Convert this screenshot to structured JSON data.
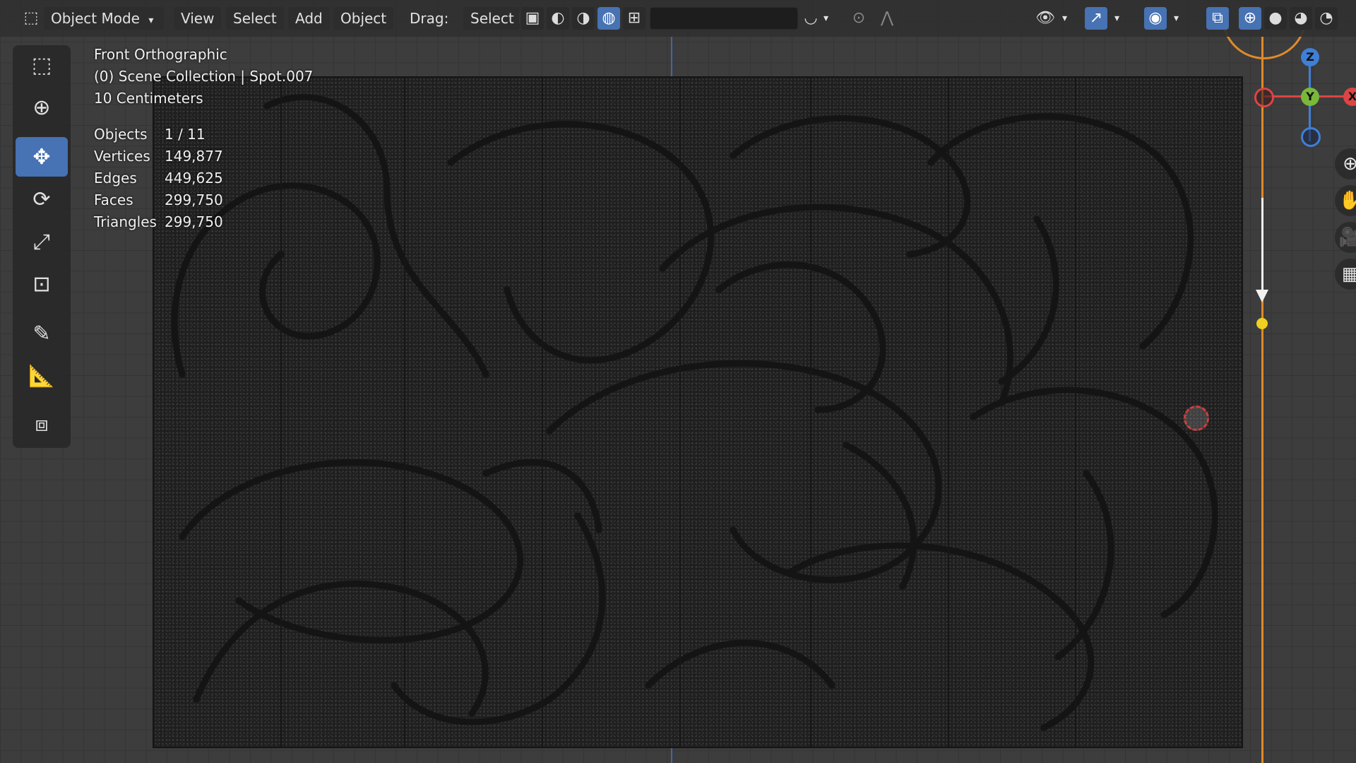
{
  "header": {
    "mode_label": "Object Mode",
    "menu": [
      "View",
      "Select",
      "Add",
      "Object"
    ],
    "drag_label": "Drag:",
    "drag_value": "Select I"
  },
  "overlay": {
    "view_name": "Front Orthographic",
    "collection": "(0) Scene Collection | Spot.007",
    "scale": "10 Centimeters",
    "stats": [
      {
        "label": "Objects",
        "value": "1 / 11"
      },
      {
        "label": "Vertices",
        "value": "149,877"
      },
      {
        "label": "Edges",
        "value": "449,625"
      },
      {
        "label": "Faces",
        "value": "299,750"
      },
      {
        "label": "Triangles",
        "value": "299,750"
      }
    ]
  },
  "gizmo": {
    "z": "Z",
    "y": "Y",
    "x": "X"
  },
  "colors": {
    "accent": "#4772b3",
    "light_line": "#e08a2a",
    "cursor": "#d23c3c"
  },
  "icons": {
    "toolbar": [
      "select-box-icon",
      "cursor-icon",
      "move-icon",
      "rotate-icon",
      "scale-icon",
      "transform-icon",
      "annotate-icon",
      "measure-icon",
      "add-cube-icon"
    ],
    "nav": [
      "zoom-icon",
      "pan-hand-icon",
      "camera-icon",
      "grid-icon"
    ]
  }
}
